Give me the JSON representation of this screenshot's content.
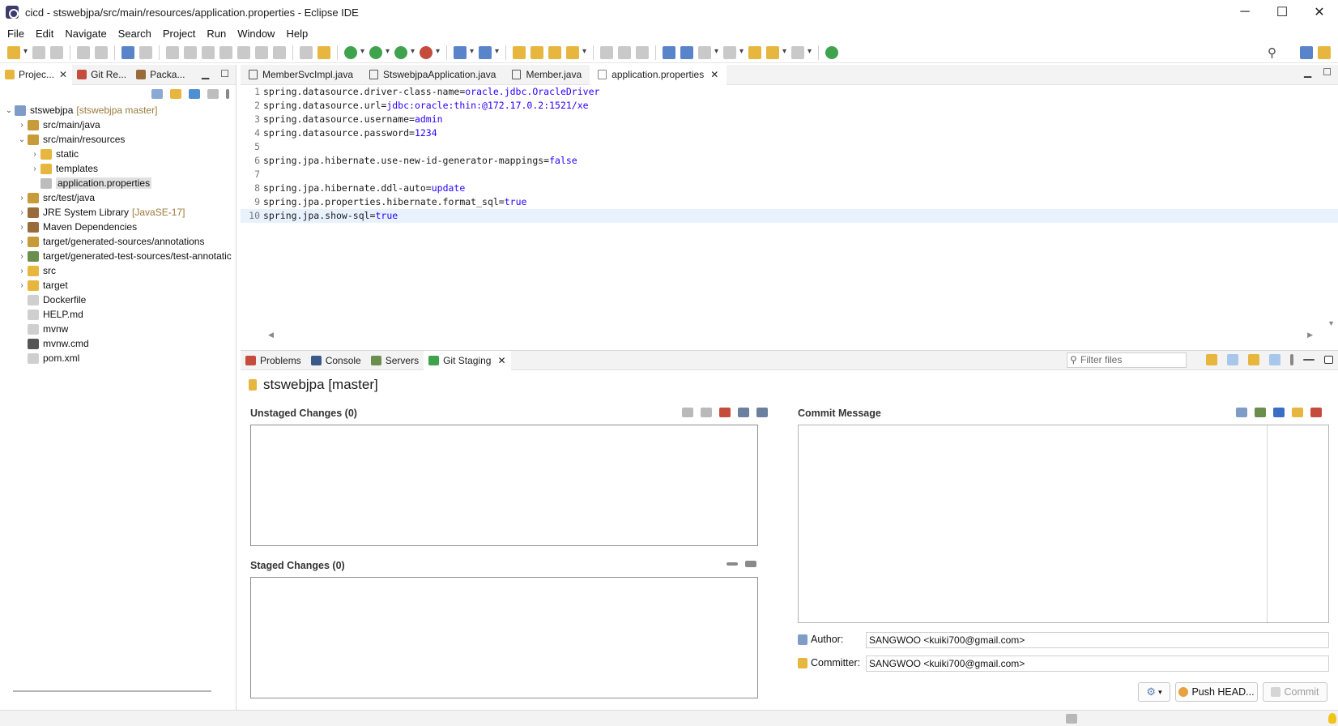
{
  "window": {
    "title": "cicd - stswebjpa/src/main/resources/application.properties - Eclipse IDE",
    "controls": [
      "─",
      "☐",
      "✕"
    ]
  },
  "menu": [
    "File",
    "Edit",
    "Navigate",
    "Search",
    "Project",
    "Run",
    "Window",
    "Help"
  ],
  "left_panel": {
    "tabs": [
      {
        "label": "Projec...",
        "active": true
      },
      {
        "label": "Git Re..."
      },
      {
        "label": "Packa..."
      }
    ],
    "tree": [
      {
        "label": "stswebjpa",
        "deco": "[stswebjpa master]",
        "level": 0,
        "arrow": "⌄"
      },
      {
        "label": "src/main/java",
        "level": 1,
        "arrow": "›"
      },
      {
        "label": "src/main/resources",
        "level": 1,
        "arrow": "⌄"
      },
      {
        "label": "static",
        "level": 2,
        "arrow": "›"
      },
      {
        "label": "templates",
        "level": 2,
        "arrow": "›"
      },
      {
        "label": "application.properties",
        "level": 2,
        "arrow": "",
        "selected": true
      },
      {
        "label": "src/test/java",
        "level": 1,
        "arrow": "›"
      },
      {
        "label": "JRE System Library",
        "deco": "[JavaSE-17]",
        "level": 1,
        "arrow": "›"
      },
      {
        "label": "Maven Dependencies",
        "level": 1,
        "arrow": "›"
      },
      {
        "label": "target/generated-sources/annotations",
        "level": 1,
        "arrow": "›"
      },
      {
        "label": "target/generated-test-sources/test-annotatic",
        "level": 1,
        "arrow": "›"
      },
      {
        "label": "src",
        "level": 1,
        "arrow": "›"
      },
      {
        "label": "target",
        "level": 1,
        "arrow": "›"
      },
      {
        "label": "Dockerfile",
        "level": 1,
        "arrow": ""
      },
      {
        "label": "HELP.md",
        "level": 1,
        "arrow": ""
      },
      {
        "label": "mvnw",
        "level": 1,
        "arrow": ""
      },
      {
        "label": "mvnw.cmd",
        "level": 1,
        "arrow": ""
      },
      {
        "label": "pom.xml",
        "level": 1,
        "arrow": ""
      }
    ]
  },
  "editor": {
    "tabs": [
      {
        "label": "MemberSvcImpl.java"
      },
      {
        "label": "StswebjpaApplication.java"
      },
      {
        "label": "Member.java"
      },
      {
        "label": "application.properties",
        "active": true
      }
    ],
    "lines": [
      {
        "n": "1",
        "key": "spring.datasource.driver-class-name=",
        "val": "oracle.jdbc.OracleDriver"
      },
      {
        "n": "2",
        "key": "spring.datasource.url=",
        "val": "jdbc:oracle:thin:@172.17.0.2:1521/xe"
      },
      {
        "n": "3",
        "key": "spring.datasource.username=",
        "val": "admin"
      },
      {
        "n": "4",
        "key": "spring.datasource.password=",
        "val": "1234"
      },
      {
        "n": "5",
        "key": "",
        "val": ""
      },
      {
        "n": "6",
        "key": "spring.jpa.hibernate.use-new-id-generator-mappings=",
        "val": "false"
      },
      {
        "n": "7",
        "key": "",
        "val": ""
      },
      {
        "n": "8",
        "key": "spring.jpa.hibernate.ddl-auto=",
        "val": "update"
      },
      {
        "n": "9",
        "key": "spring.jpa.properties.hibernate.format_sql=",
        "val": "true"
      },
      {
        "n": "10",
        "key": "spring.jpa.show-sql=",
        "val": "true",
        "highlight": true
      }
    ]
  },
  "bottom": {
    "tabs": [
      {
        "label": "Problems"
      },
      {
        "label": "Console"
      },
      {
        "label": "Servers"
      },
      {
        "label": "Git Staging",
        "active": true
      }
    ],
    "filter_placeholder": "Filter files",
    "repo_title": "stswebjpa [master]",
    "unstaged_title": "Unstaged Changes (0)",
    "staged_title": "Staged Changes (0)",
    "commit_title": "Commit Message",
    "author_label": "Author:",
    "author_value": "SANGWOO <kuiki700@gmail.com>",
    "committer_label": "Committer:",
    "committer_value": "SANGWOO <kuiki700@gmail.com>",
    "push_label": "Push HEAD...",
    "commit_label": "Commit"
  },
  "colors": {
    "accent": "#2a00ff",
    "selection": "#e0e0e0",
    "line_highlight": "#e8f2fe"
  }
}
